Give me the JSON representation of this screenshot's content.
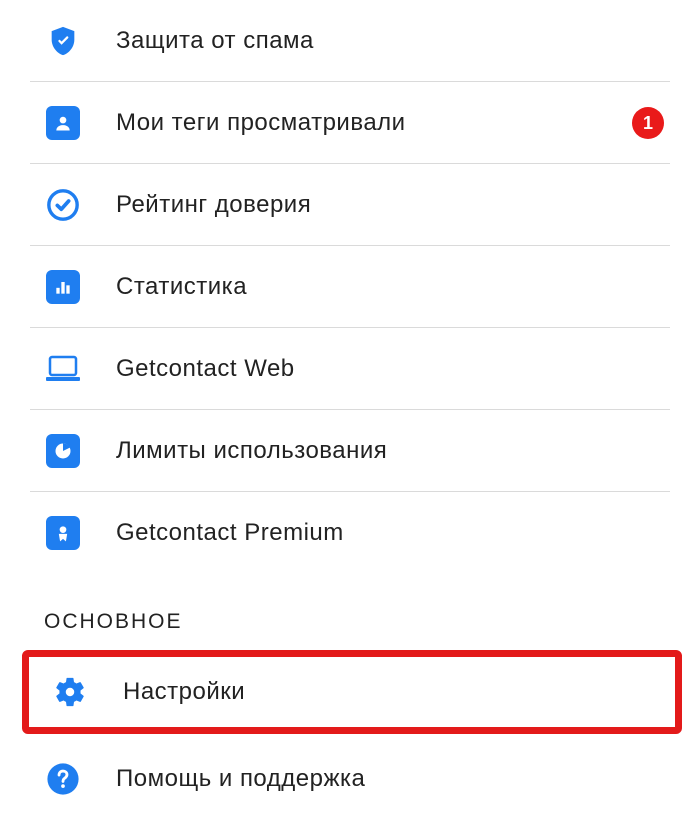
{
  "menu": {
    "items": [
      {
        "label": "Защита от спама"
      },
      {
        "label": "Мои теги просматривали",
        "badge": "1"
      },
      {
        "label": "Рейтинг доверия"
      },
      {
        "label": "Статистика"
      },
      {
        "label": "Getcontact Web"
      },
      {
        "label": "Лимиты использования"
      },
      {
        "label": "Getcontact Premium"
      }
    ],
    "section_header": "ОСНОВНОЕ",
    "main_items": [
      {
        "label": "Настройки"
      },
      {
        "label": "Помощь и поддержка"
      }
    ]
  },
  "colors": {
    "accent": "#1f7ef0",
    "badge": "#e91a1a",
    "highlight": "#e31a1a"
  }
}
